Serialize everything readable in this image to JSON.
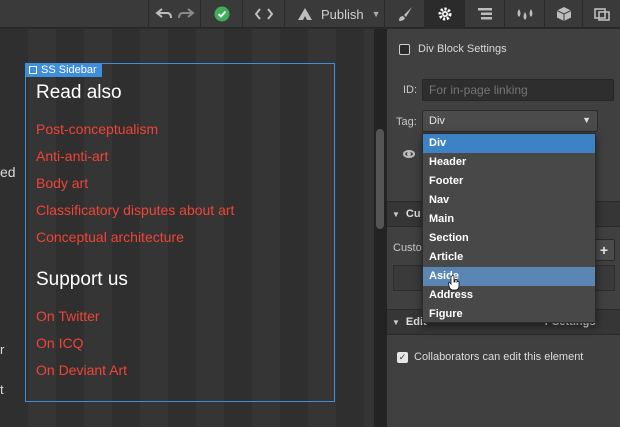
{
  "toolbar": {
    "publish_label": "Publish",
    "icons": [
      "undo-icon",
      "redo-icon",
      "check-icon",
      "code-icon",
      "publish-icon",
      "brush-icon",
      "gear-icon",
      "navigator-icon",
      "drops-icon",
      "box-icon",
      "swap-icon"
    ]
  },
  "canvas": {
    "edge_text": [
      "ed",
      "r",
      "t"
    ],
    "selection_label": "SS Sidebar",
    "read_also_heading": "Read also",
    "read_also_links": [
      "Post-conceptualism",
      "Anti-anti-art",
      "Body art",
      "Classificatory disputes about art",
      "Conceptual architecture"
    ],
    "support_heading": "Support us",
    "support_links": [
      "On Twitter",
      "On ICQ",
      "On Deviant Art"
    ]
  },
  "panel": {
    "block_settings_label": "Div Block Settings",
    "id_label": "ID:",
    "id_placeholder": "For in-page linking",
    "tag_label": "Tag:",
    "tag_value": "Div",
    "custom_section_label": "Cu",
    "custom_label": "Custo",
    "add_button": "+",
    "editor_section_label": "Edit",
    "editor_section_tail": "r Settings",
    "collaborators_label": "Collaborators can edit this element"
  },
  "dropdown": {
    "options": [
      "Div",
      "Header",
      "Footer",
      "Nav",
      "Main",
      "Section",
      "Article",
      "Aside",
      "Address",
      "Figure"
    ],
    "selected": "Div",
    "hovered": "Aside"
  },
  "colors": {
    "accent": "#3f8ede",
    "link": "#f04438",
    "check_green": "#3fae5b"
  }
}
